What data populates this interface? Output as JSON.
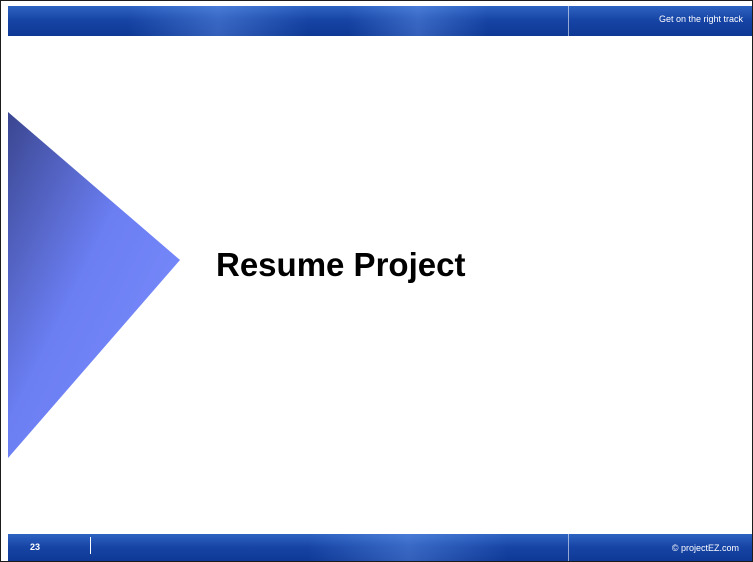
{
  "header": {
    "tagline": "Get on the right track"
  },
  "slide": {
    "title": "Resume Project"
  },
  "footer": {
    "page_number": "23",
    "copyright": "© projectEZ.com"
  },
  "colors": {
    "bar_blue": "#1745a6",
    "bar_blue_light": "#2f63c2",
    "triangle_dark": "#3a4a8a",
    "triangle_light": "#7b8dff",
    "title_text": "#000000"
  },
  "icons": {
    "decoration": "triangle-decoration"
  }
}
